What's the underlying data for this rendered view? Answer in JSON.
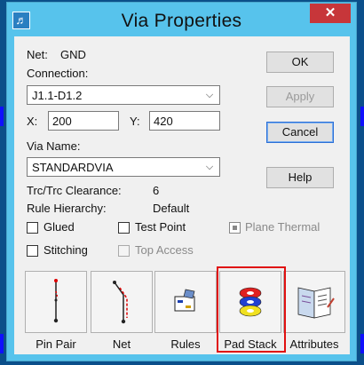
{
  "window": {
    "title": "Via Properties",
    "close_glyph": "✕",
    "app_icon_glyph": "♬"
  },
  "fields": {
    "net_label": "Net:",
    "net_value": "GND",
    "connection_label": "Connection:",
    "connection_value": "J1.1-D1.2",
    "x_label": "X:",
    "x_value": "200",
    "y_label": "Y:",
    "y_value": "420",
    "via_name_label": "Via Name:",
    "via_name_value": "STANDARDVIA",
    "clearance_label": "Trc/Trc Clearance:",
    "clearance_value": "6",
    "hierarchy_label": "Rule Hierarchy:",
    "hierarchy_value": "Default"
  },
  "checkboxes": {
    "glued": "Glued",
    "test_point": "Test Point",
    "plane_thermal": "Plane Thermal",
    "stitching": "Stitching",
    "top_access": "Top Access"
  },
  "buttons": {
    "ok": "OK",
    "apply": "Apply",
    "cancel": "Cancel",
    "help": "Help"
  },
  "tool_buttons": [
    {
      "label": "Pin Pair",
      "icon": "pin-pair-icon"
    },
    {
      "label": "Net",
      "icon": "net-icon"
    },
    {
      "label": "Rules",
      "icon": "rules-icon"
    },
    {
      "label": "Pad Stack",
      "icon": "pad-stack-icon"
    },
    {
      "label": "Attributes",
      "icon": "attributes-icon"
    }
  ],
  "colors": {
    "titlebar": "#57c3ec",
    "close": "#c7363a",
    "highlight": "#e01010"
  }
}
